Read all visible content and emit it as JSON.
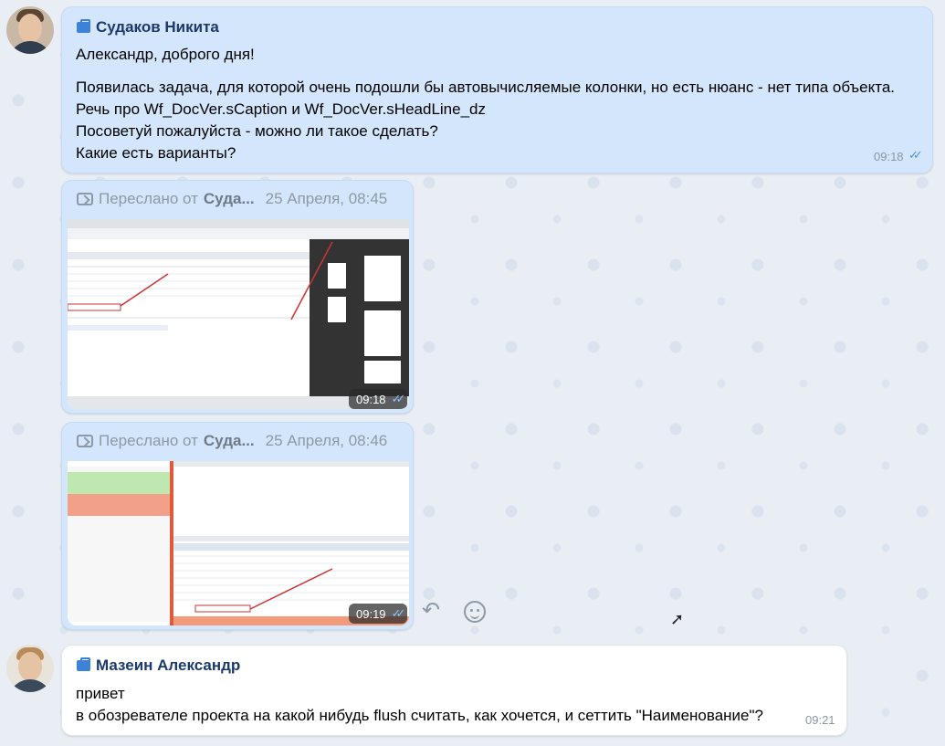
{
  "messages": [
    {
      "sender": "Судаков Никита",
      "lines": [
        "Александр, доброго дня!",
        "Появилась задача, для которой очень подошли бы автовычисляемые колонки, но есть нюанс - нет типа объекта.",
        "Речь про Wf_DocVer.sCaption и Wf_DocVer.sHeadLine_dz",
        "Посоветуй пожалуйста - можно ли такое сделать?",
        "Какие есть варианты?"
      ],
      "time": "09:18"
    },
    {
      "forward_label": "Переслано от",
      "forward_from": "Суда...",
      "forward_date": "25 Апреля, 08:45",
      "time": "09:18"
    },
    {
      "forward_label": "Переслано от",
      "forward_from": "Суда...",
      "forward_date": "25 Апреля, 08:46",
      "time": "09:19"
    },
    {
      "sender": "Мазеин Александр",
      "lines": [
        "привет",
        "в обозревателе проекта на какой нибудь flush считать, как хочется, и сеттить \"Наименование\"?"
      ],
      "time": "09:21"
    }
  ],
  "icons": {
    "briefcase": "briefcase-icon",
    "forward": "forward-icon",
    "read_checks": "double-check-icon",
    "reply": "reply-icon",
    "emoji": "emoji-icon",
    "cursor": "mouse-cursor-icon"
  },
  "colors": {
    "own_bubble": "#d4e6fb",
    "other_bubble": "#ffffff",
    "sender_name": "#1b3a6b",
    "accent": "#3c82d8"
  }
}
